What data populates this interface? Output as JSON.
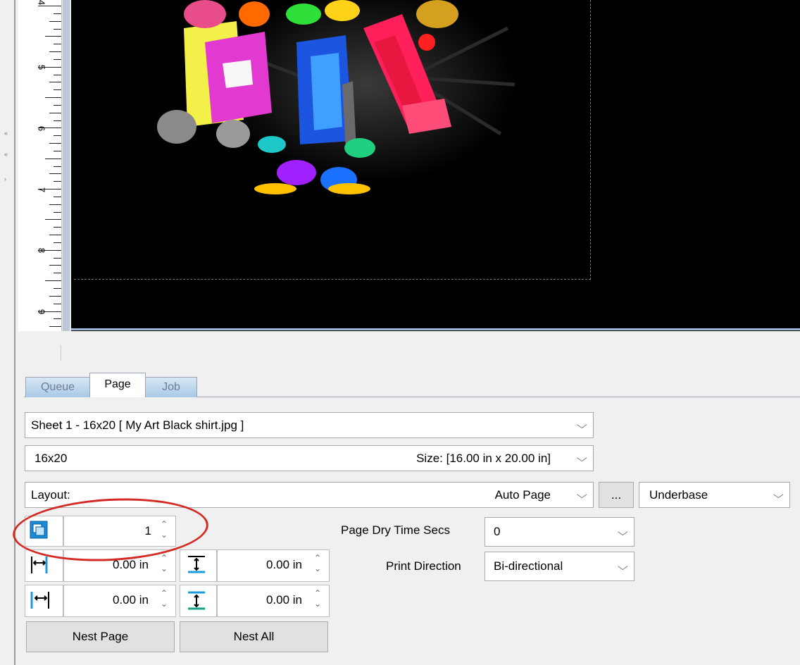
{
  "ruler": {
    "numbers": [
      "4",
      "5",
      "6",
      "7",
      "8",
      "9"
    ]
  },
  "tabs": [
    {
      "label": "Queue"
    },
    {
      "label": "Page"
    },
    {
      "label": "Job"
    }
  ],
  "sheet_select": {
    "value": "Sheet 1 - 16x20 [ My Art Black shirt.jpg ]"
  },
  "size_select": {
    "name": "16x20",
    "size_text": "Size: [16.00 in x 20.00 in]"
  },
  "layout": {
    "label": "Layout:",
    "value": "Auto Page",
    "more_label": "...",
    "ink_value": "Underbase"
  },
  "copies": {
    "value": "1"
  },
  "page_dry_time": {
    "label": "Page Dry Time Secs",
    "value": "0"
  },
  "print_direction": {
    "label": "Print Direction",
    "value": "Bi-directional"
  },
  "margins": {
    "left": "0.00 in",
    "top": "0.00 in",
    "right": "0.00 in",
    "bottom": "0.00 in"
  },
  "buttons": {
    "nest_page": "Nest Page",
    "nest_all": "Nest All"
  },
  "colors": {
    "canvas": "#000000",
    "highlight": "#d52a24",
    "tab_inactive": "#a9c9e6"
  }
}
